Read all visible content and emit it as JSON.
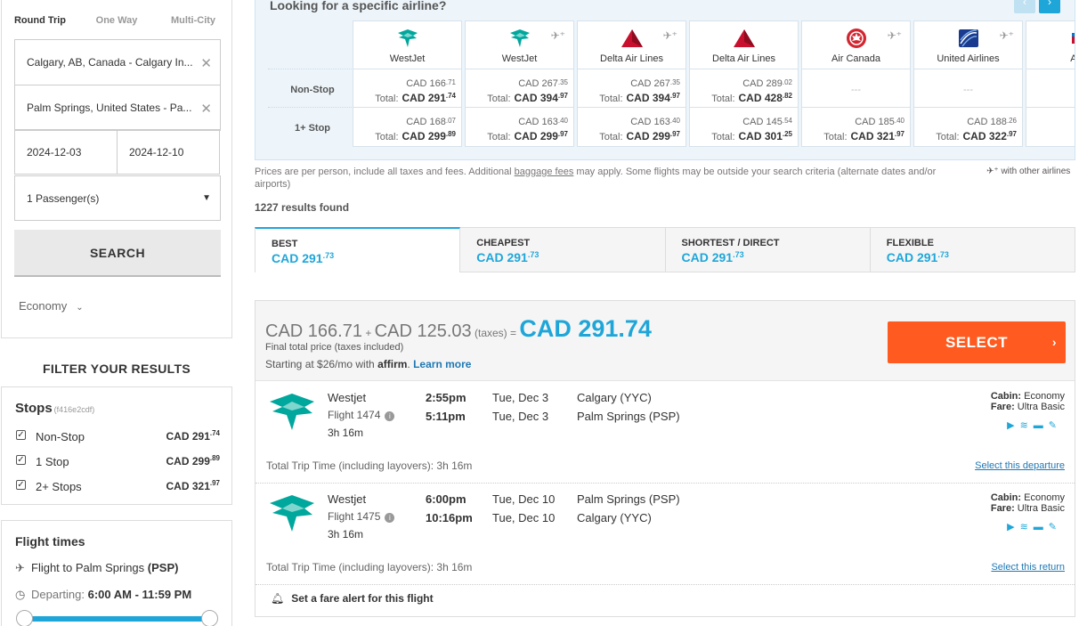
{
  "search": {
    "trip_tabs": [
      "Round Trip",
      "One Way",
      "Multi-City"
    ],
    "origin": "Calgary, AB, Canada - Calgary In...",
    "destination": "Palm Springs, United States - Pa...",
    "depart_date": "2024-12-03",
    "return_date": "2024-12-10",
    "passengers": "1 Passenger(s)",
    "search_label": "SEARCH",
    "cabin": "Economy"
  },
  "filters": {
    "title": "FILTER YOUR RESULTS",
    "stops_title": "Stops",
    "stops_hash": "(f416e2cdf)",
    "stops": [
      {
        "label": "Non-Stop",
        "price": "CAD 291",
        "cents": ".74"
      },
      {
        "label": "1 Stop",
        "price": "CAD 299",
        "cents": ".89"
      },
      {
        "label": "2+ Stops",
        "price": "CAD 321",
        "cents": ".97"
      }
    ],
    "times_title": "Flight times",
    "times_to": "Flight to Palm Springs",
    "times_to_code": "(PSP)",
    "departing_label": "Departing:",
    "departing_value": "6:00 AM - 11:59 PM"
  },
  "matrix": {
    "title": "Looking for a specific airline?",
    "row_labels": [
      "Non-Stop",
      "1+ Stop"
    ],
    "total_label": "Total:",
    "dash": "---",
    "airlines": [
      {
        "name": "WestJet",
        "logo": "westjet",
        "plus": false,
        "nonstop": {
          "base": "CAD 166",
          "base_c": ".71",
          "total": "CAD 291",
          "total_c": ".74"
        },
        "onestop": {
          "base": "CAD 168",
          "base_c": ".07",
          "total": "CAD 299",
          "total_c": ".89"
        }
      },
      {
        "name": "WestJet",
        "logo": "westjet",
        "plus": true,
        "nonstop": {
          "base": "CAD 267",
          "base_c": ".35",
          "total": "CAD 394",
          "total_c": ".97"
        },
        "onestop": {
          "base": "CAD 163",
          "base_c": ".40",
          "total": "CAD 299",
          "total_c": ".97"
        }
      },
      {
        "name": "Delta Air Lines",
        "logo": "delta",
        "plus": true,
        "nonstop": {
          "base": "CAD 267",
          "base_c": ".35",
          "total": "CAD 394",
          "total_c": ".97"
        },
        "onestop": {
          "base": "CAD 163",
          "base_c": ".40",
          "total": "CAD 299",
          "total_c": ".97"
        }
      },
      {
        "name": "Delta Air Lines",
        "logo": "delta",
        "plus": false,
        "nonstop": {
          "base": "CAD 289",
          "base_c": ".02",
          "total": "CAD 428",
          "total_c": ".82"
        },
        "onestop": {
          "base": "CAD 145",
          "base_c": ".54",
          "total": "CAD 301",
          "total_c": ".25"
        }
      },
      {
        "name": "Air Canada",
        "logo": "aircanada",
        "plus": true,
        "nonstop": null,
        "onestop": {
          "base": "CAD 185",
          "base_c": ".40",
          "total": "CAD 321",
          "total_c": ".97"
        }
      },
      {
        "name": "United Airlines",
        "logo": "united",
        "plus": true,
        "nonstop": null,
        "onestop": {
          "base": "CAD 188",
          "base_c": ".26",
          "total": "CAD 322",
          "total_c": ".97"
        }
      },
      {
        "name": "Ame",
        "logo": "american",
        "plus": false,
        "nonstop": null,
        "onestop": {
          "base": "",
          "base_c": "",
          "total": "",
          "total_c": ""
        }
      }
    ]
  },
  "disclaimer": {
    "pre": "Prices are per person, include all taxes and fees. Additional ",
    "link": "baggage fees",
    "post": " may apply. Some flights may be outside your search criteria (alternate dates and/or airports)",
    "other_airlines": "with other airlines"
  },
  "results_count": "1227 results found",
  "sort_tabs": [
    {
      "key": "BEST",
      "price": "CAD 291",
      "cents": ".73"
    },
    {
      "key": "CHEAPEST",
      "price": "CAD 291",
      "cents": ".73"
    },
    {
      "key": "SHORTEST / DIRECT",
      "price": "CAD 291",
      "cents": ".73"
    },
    {
      "key": "FLEXIBLE",
      "price": "CAD 291",
      "cents": ".73"
    }
  ],
  "result": {
    "base": "CAD 166.71",
    "plus": "+",
    "taxes": "CAD 125.03",
    "taxes_label": "(taxes) =",
    "total": "CAD 291.74",
    "final_note": "Final total price (taxes included)",
    "affirm_pre": "Starting at $26/mo with",
    "affirm_brand": "affirm",
    "affirm_link": "Learn more",
    "select_label": "SELECT",
    "legs": [
      {
        "airline": "Westjet",
        "flight": "Flight 1474",
        "duration": "3h 16m",
        "dep_time": "2:55pm",
        "arr_time": "5:11pm",
        "dep_date": "Tue, Dec 3",
        "arr_date": "Tue, Dec 3",
        "dep_airport": "Calgary (YYC)",
        "arr_airport": "Palm Springs (PSP)",
        "cabin_label": "Cabin:",
        "cabin": "Economy",
        "fare_label": "Fare:",
        "fare": "Ultra Basic",
        "total_time": "Total Trip Time (including layovers): 3h 16m",
        "link": "Select this departure"
      },
      {
        "airline": "Westjet",
        "flight": "Flight 1475",
        "duration": "3h 16m",
        "dep_time": "6:00pm",
        "arr_time": "10:16pm",
        "dep_date": "Tue, Dec 10",
        "arr_date": "Tue, Dec 10",
        "dep_airport": "Palm Springs (PSP)",
        "arr_airport": "Calgary (YYC)",
        "cabin_label": "Cabin:",
        "cabin": "Economy",
        "fare_label": "Fare:",
        "fare": "Ultra Basic",
        "total_time": "Total Trip Time (including layovers): 3h 16m",
        "link": "Select this return"
      }
    ],
    "fare_alert": "Set a fare alert for this flight"
  },
  "colors": {
    "accent": "#1fa6d9",
    "select": "#ff5a1f",
    "westjet": "#00a79d",
    "delta": "#c8102e",
    "aircanada": "#d22630",
    "united": "#1a3a8f"
  }
}
